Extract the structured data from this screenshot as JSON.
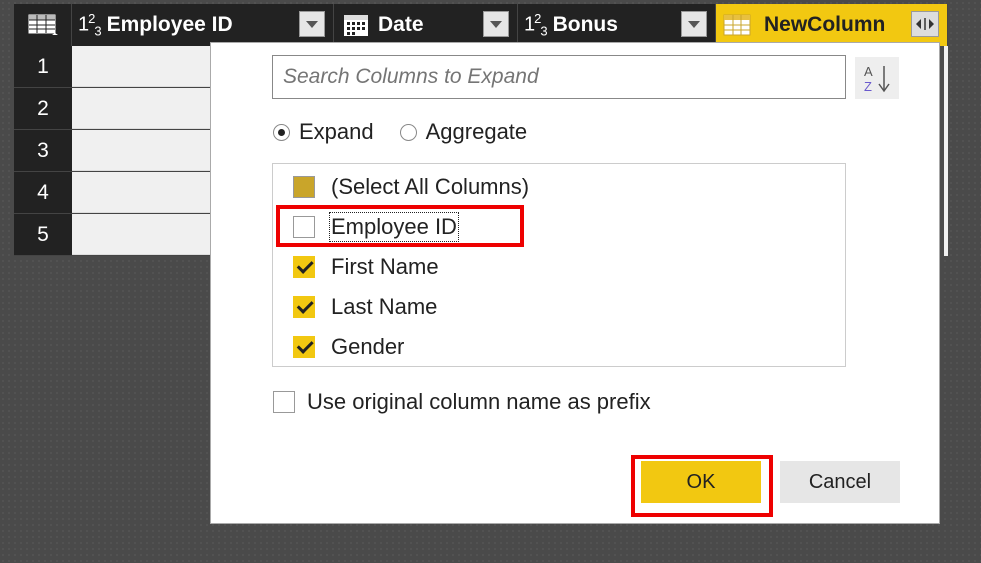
{
  "header": {
    "columns": [
      {
        "type": "table",
        "label": ""
      },
      {
        "type": "123",
        "label": "Employee ID"
      },
      {
        "type": "date",
        "label": "Date"
      },
      {
        "type": "123",
        "label": "Bonus"
      },
      {
        "type": "table",
        "label": "NewColumn"
      }
    ],
    "type_123": {
      "a": "1",
      "b": "2",
      "c": "3"
    }
  },
  "rows": [
    "1",
    "2",
    "3",
    "4",
    "5"
  ],
  "dialog": {
    "search_placeholder": "Search Columns to Expand",
    "sort_label_top": "A",
    "sort_label_bottom": "Z",
    "radio_expand": "Expand",
    "radio_aggregate": "Aggregate",
    "selected_mode": "Expand",
    "items": [
      {
        "label": "(Select All Columns)",
        "state": "partial"
      },
      {
        "label": "Employee ID",
        "state": "unchecked"
      },
      {
        "label": "First Name",
        "state": "checked"
      },
      {
        "label": "Last Name",
        "state": "checked"
      },
      {
        "label": "Gender",
        "state": "checked"
      }
    ],
    "prefix_label": "Use original column name as prefix",
    "prefix_checked": false,
    "ok_label": "OK",
    "cancel_label": "Cancel"
  },
  "colors": {
    "accent": "#f2c811",
    "highlight": "#e00000",
    "header_bg": "#222222"
  }
}
